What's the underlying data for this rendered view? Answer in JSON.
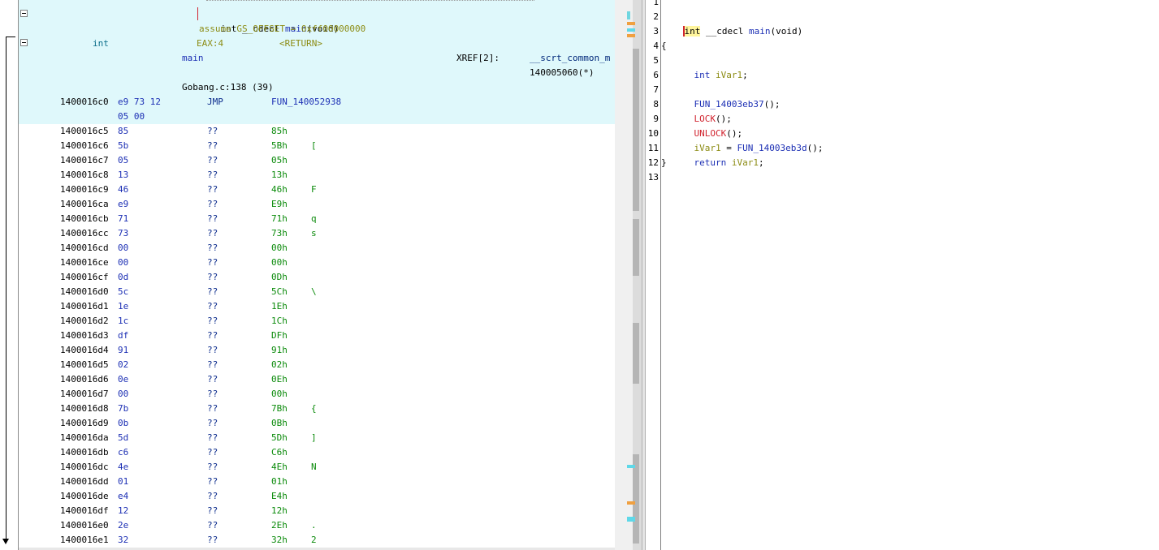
{
  "listing": {
    "signature": {
      "ret": "int",
      "conv": "__cdecl",
      "name": "main",
      "params": "(void)"
    },
    "assume": "assume GS_OFFSET = 0xff00000000",
    "return_type": "int",
    "return_storage": "EAX:4",
    "return_name": "<RETURN>",
    "label": "main",
    "xref_label": "XREF[2]:",
    "xref1": "__scrt_common_m",
    "xref2": "140005060(*)",
    "source_line": "Gobang.c:138 (39)",
    "jmp_row": {
      "addr": "1400016c0",
      "bytes1": "e9 73 12",
      "bytes2": "05 00",
      "mnemonic": "JMP",
      "operand": "FUN_140052938"
    },
    "rows": [
      {
        "addr": "1400016c5",
        "byte": "85",
        "mn": "??",
        "val": "85h",
        "chr": ""
      },
      {
        "addr": "1400016c6",
        "byte": "5b",
        "mn": "??",
        "val": "5Bh",
        "chr": "["
      },
      {
        "addr": "1400016c7",
        "byte": "05",
        "mn": "??",
        "val": "05h",
        "chr": ""
      },
      {
        "addr": "1400016c8",
        "byte": "13",
        "mn": "??",
        "val": "13h",
        "chr": ""
      },
      {
        "addr": "1400016c9",
        "byte": "46",
        "mn": "??",
        "val": "46h",
        "chr": "F"
      },
      {
        "addr": "1400016ca",
        "byte": "e9",
        "mn": "??",
        "val": "E9h",
        "chr": ""
      },
      {
        "addr": "1400016cb",
        "byte": "71",
        "mn": "??",
        "val": "71h",
        "chr": "q"
      },
      {
        "addr": "1400016cc",
        "byte": "73",
        "mn": "??",
        "val": "73h",
        "chr": "s"
      },
      {
        "addr": "1400016cd",
        "byte": "00",
        "mn": "??",
        "val": "00h",
        "chr": ""
      },
      {
        "addr": "1400016ce",
        "byte": "00",
        "mn": "??",
        "val": "00h",
        "chr": ""
      },
      {
        "addr": "1400016cf",
        "byte": "0d",
        "mn": "??",
        "val": "0Dh",
        "chr": ""
      },
      {
        "addr": "1400016d0",
        "byte": "5c",
        "mn": "??",
        "val": "5Ch",
        "chr": "\\"
      },
      {
        "addr": "1400016d1",
        "byte": "1e",
        "mn": "??",
        "val": "1Eh",
        "chr": ""
      },
      {
        "addr": "1400016d2",
        "byte": "1c",
        "mn": "??",
        "val": "1Ch",
        "chr": ""
      },
      {
        "addr": "1400016d3",
        "byte": "df",
        "mn": "??",
        "val": "DFh",
        "chr": ""
      },
      {
        "addr": "1400016d4",
        "byte": "91",
        "mn": "??",
        "val": "91h",
        "chr": ""
      },
      {
        "addr": "1400016d5",
        "byte": "02",
        "mn": "??",
        "val": "02h",
        "chr": ""
      },
      {
        "addr": "1400016d6",
        "byte": "0e",
        "mn": "??",
        "val": "0Eh",
        "chr": ""
      },
      {
        "addr": "1400016d7",
        "byte": "00",
        "mn": "??",
        "val": "00h",
        "chr": ""
      },
      {
        "addr": "1400016d8",
        "byte": "7b",
        "mn": "??",
        "val": "7Bh",
        "chr": "{"
      },
      {
        "addr": "1400016d9",
        "byte": "0b",
        "mn": "??",
        "val": "0Bh",
        "chr": ""
      },
      {
        "addr": "1400016da",
        "byte": "5d",
        "mn": "??",
        "val": "5Dh",
        "chr": "]"
      },
      {
        "addr": "1400016db",
        "byte": "c6",
        "mn": "??",
        "val": "C6h",
        "chr": ""
      },
      {
        "addr": "1400016dc",
        "byte": "4e",
        "mn": "??",
        "val": "4Eh",
        "chr": "N"
      },
      {
        "addr": "1400016dd",
        "byte": "01",
        "mn": "??",
        "val": "01h",
        "chr": ""
      },
      {
        "addr": "1400016de",
        "byte": "e4",
        "mn": "??",
        "val": "E4h",
        "chr": ""
      },
      {
        "addr": "1400016df",
        "byte": "12",
        "mn": "??",
        "val": "12h",
        "chr": ""
      },
      {
        "addr": "1400016e0",
        "byte": "2e",
        "mn": "??",
        "val": "2Eh",
        "chr": "."
      },
      {
        "addr": "1400016e1",
        "byte": "32",
        "mn": "??",
        "val": "32h",
        "chr": "2"
      }
    ]
  },
  "decompiler": {
    "line_numbers": [
      "1",
      "2",
      "3",
      "4",
      "5",
      "6",
      "7",
      "8",
      "9",
      "10",
      "11",
      "12",
      "13"
    ],
    "sig_int": "int",
    "sig_rest_conv": " __cdecl ",
    "sig_name": "main",
    "sig_params": "(void)",
    "open_brace": "{",
    "decl_type": "int",
    "decl_var": "iVar1",
    "decl_semi": ";",
    "call1": "FUN_14003eb37",
    "call1_tail": "();",
    "lock": "LOCK",
    "lock_tail": "();",
    "unlock": "UNLOCK",
    "unlock_tail": "();",
    "assign_var": "iVar1",
    "assign_eq": " = ",
    "assign_fn": "FUN_14003eb3d",
    "assign_tail": "();",
    "ret_kw": "return",
    "ret_var": "iVar1",
    "ret_semi": ";",
    "close_brace": "}"
  },
  "colors": {
    "function_header_bg": "#dff8fb",
    "keyword_blue": "#1c2fb4",
    "variable_olive": "#8c8c14",
    "macro_red": "#d1242f",
    "data_green": "#0a8a0a",
    "highlight_yellow": "#fff59c"
  }
}
